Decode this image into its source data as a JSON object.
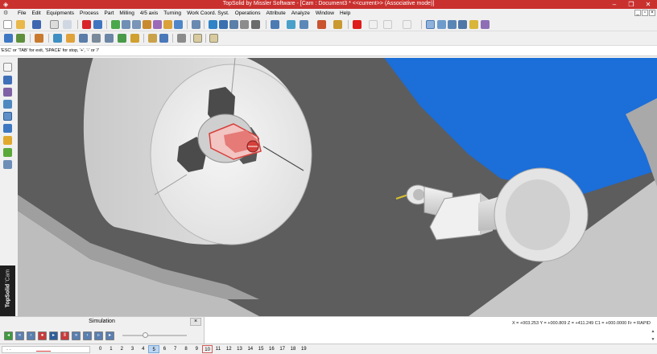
{
  "window": {
    "title": "TopSolid by Missler Software - [Cam : Document3 *  <<current>> (Associative mode)]",
    "app_icon": "topsolid-app-icon",
    "controls": [
      "minimize-icon",
      "restore-icon",
      "close-icon"
    ]
  },
  "menu": {
    "items": [
      "File",
      "Edit",
      "Equipments",
      "Process",
      "Part",
      "Milling",
      "4/5 axis",
      "Turning",
      "Work Coord. Syst.",
      "Operations",
      "Attribute",
      "Analyze",
      "Window",
      "Help"
    ]
  },
  "prompt": {
    "text": "'ESC' or 'TAB' for exit, 'SPACE' for stop, '+', '-' or '/'"
  },
  "brand": {
    "name": "TopSolid",
    "module": "'Cam"
  },
  "simulation": {
    "title": "Simulation",
    "close": "×",
    "buttons": [
      "go-start-icon",
      "step-back-fast-icon",
      "step-back-icon",
      "record-icon",
      "play-icon",
      "pause-icon",
      "step-forward-fast-icon",
      "step-forward-icon",
      "step-next-icon",
      "go-end-icon"
    ],
    "speed_position": 0.35
  },
  "status": {
    "coordinates": "X = +003.253  Y = +000.809  Z = +411.249  C1 = +000.0000  Fr = RAPID"
  },
  "layers": {
    "dots": "- -",
    "tabs": [
      "0",
      "1",
      "2",
      "3",
      "4",
      "5",
      "6",
      "7",
      "8",
      "9",
      "10",
      "11",
      "12",
      "13",
      "14",
      "15",
      "16",
      "17",
      "18",
      "19"
    ],
    "current": "10",
    "highlighted": "5"
  },
  "colors": {
    "title_bar": "#c9312f",
    "viewport_background": "#5b5b5b",
    "sky_blue": "#1c6ed8",
    "part_red": "#d6403b"
  }
}
